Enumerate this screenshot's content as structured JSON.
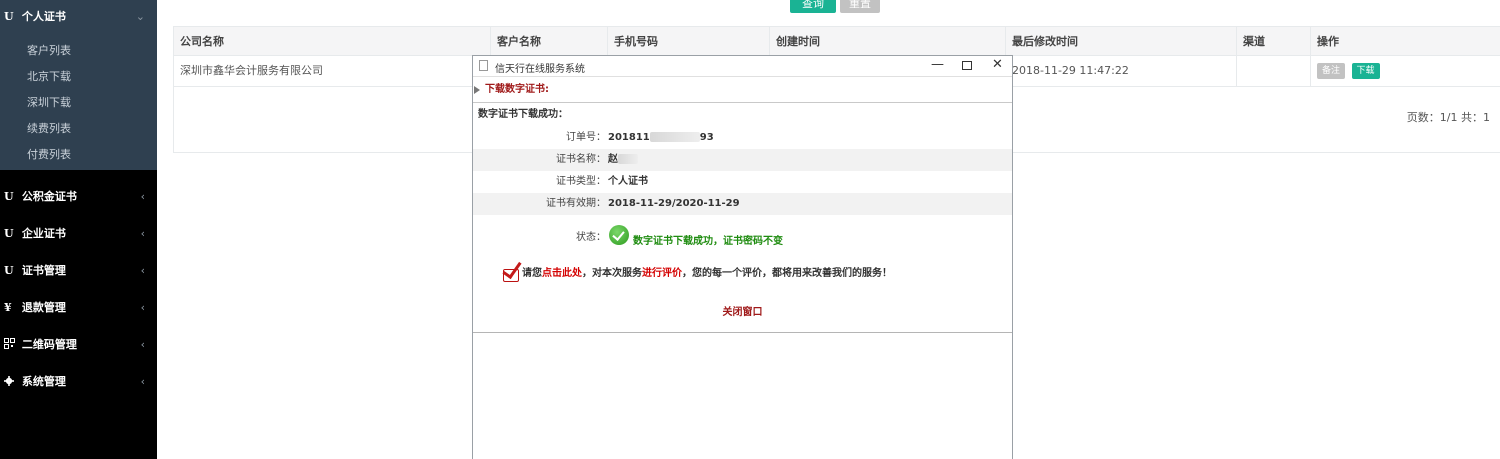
{
  "sidebar": {
    "active_group": {
      "icon": "U",
      "label": "个人证书",
      "chevron": "⌄"
    },
    "sub_items": [
      "客户列表",
      "北京下载",
      "深圳下载",
      "续费列表",
      "付费列表"
    ],
    "groups": [
      {
        "icon": "U",
        "label": "公积金证书",
        "chevron": "‹"
      },
      {
        "icon": "U",
        "label": "企业证书",
        "chevron": "‹"
      },
      {
        "icon": "U",
        "label": "证书管理",
        "chevron": "‹"
      },
      {
        "icon": "¥",
        "label": "退款管理",
        "chevron": "‹"
      },
      {
        "icon": "qr-code-icon",
        "label": "二维码管理",
        "chevron": "‹"
      },
      {
        "icon": "gear-icon",
        "label": "系统管理",
        "chevron": "‹"
      }
    ]
  },
  "toolbar": {
    "query_label": "查询",
    "reset_label": "重置"
  },
  "table": {
    "headers": [
      "公司名称",
      "客户名称",
      "手机号码",
      "创建时间",
      "最后修改时间",
      "渠道",
      "操作"
    ],
    "row": {
      "company": "深圳市鑫华会计服务有限公司",
      "modified": "2018-11-29 11:47:22",
      "note_label": "备注",
      "download_label": "下载"
    },
    "pager": "页数：1/1 共：1"
  },
  "popup": {
    "title": "信天行在线服务系统",
    "min_glyph": "—",
    "close_glyph": "✕",
    "section_title": "下载数字证书:",
    "success_title": "数字证书下载成功：",
    "order_label": "订单号：",
    "order_prefix": "201811",
    "order_suffix": "93",
    "cert_name_label": "证书名称：",
    "cert_name_prefix": "赵",
    "cert_type_label": "证书类型：",
    "cert_type": "个人证书",
    "validity_label": "证书有效期：",
    "validity": "2018-11-29/2020-11-29",
    "status_label": "状态：",
    "status_text": "数字证书下载成功，证书密码不变",
    "rate_1": "请您",
    "rate_link": "点击此处",
    "rate_2": "，对本次服务",
    "rate_em": "进行评价",
    "rate_3": "，您的每一个评价，都将用来改善我们的服务！",
    "close_window": "关闭窗口"
  }
}
